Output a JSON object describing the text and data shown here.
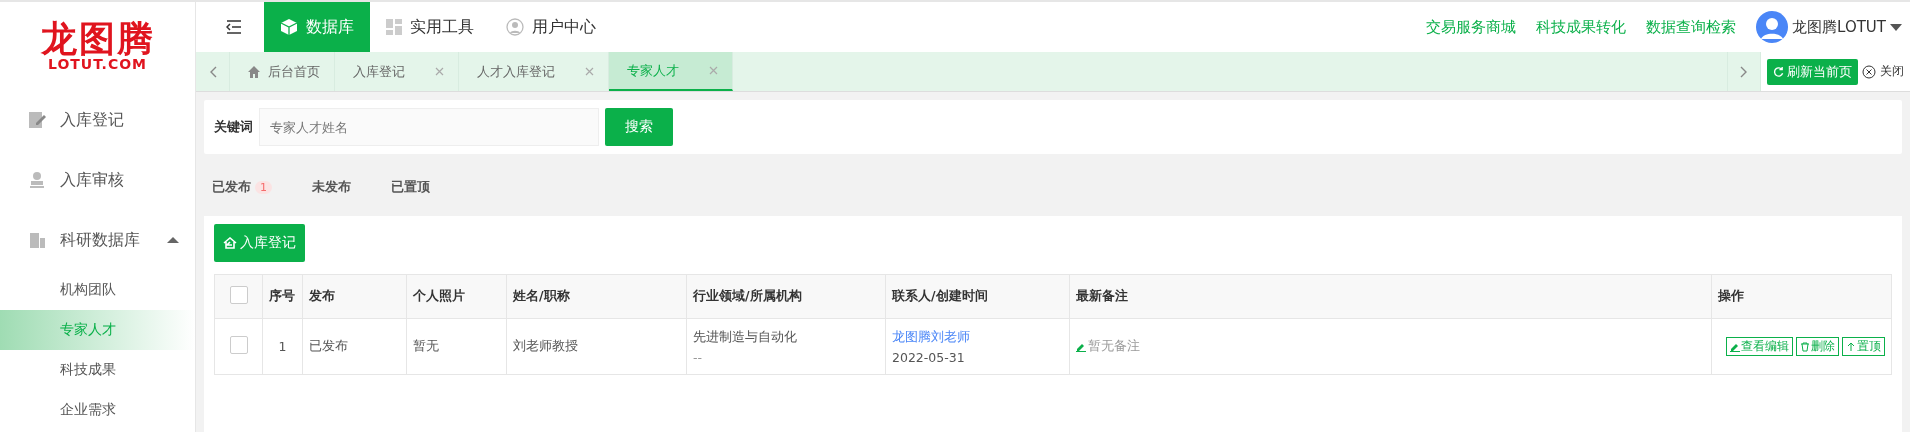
{
  "logo": {
    "title": "龙图腾",
    "subtitle": "LOTUT.COM"
  },
  "top_nav": [
    {
      "label": "数据库",
      "selected": true
    },
    {
      "label": "实用工具",
      "selected": false
    },
    {
      "label": "用户中心",
      "selected": false
    }
  ],
  "top_links": [
    "交易服务商城",
    "科技成果转化",
    "数据查询检索"
  ],
  "user": {
    "name": "龙图腾LOTUT"
  },
  "page_tabs": [
    {
      "label": "后台首页",
      "kind": "home",
      "selected": false
    },
    {
      "label": "入库登记",
      "kind": "closable",
      "selected": false
    },
    {
      "label": "人才入库登记",
      "kind": "closable",
      "selected": false
    },
    {
      "label": "专家人才",
      "kind": "closable",
      "selected": true
    }
  ],
  "refresh_button": "刷新当前页",
  "close_label": "关闭",
  "sidebar": {
    "items": [
      {
        "label": "入库登记"
      },
      {
        "label": "入库审核"
      },
      {
        "label": "科研数据库",
        "expanded": true,
        "children": [
          {
            "label": "机构团队",
            "selected": false
          },
          {
            "label": "专家人才",
            "selected": true
          },
          {
            "label": "科技成果",
            "selected": false
          },
          {
            "label": "企业需求",
            "selected": false
          }
        ]
      }
    ]
  },
  "search": {
    "label": "关键词",
    "placeholder": "专家人才姓名",
    "button": "搜索"
  },
  "status_tabs": [
    {
      "label": "已发布",
      "badge": "1"
    },
    {
      "label": "未发布"
    },
    {
      "label": "已置顶"
    }
  ],
  "add_button": "入库登记",
  "table": {
    "all_checked": false,
    "columns": [
      "序号",
      "发布",
      "个人照片",
      "姓名/职称",
      "行业领域/所属机构",
      "联系人/创建时间",
      "最新备注",
      "操作"
    ],
    "rows": [
      {
        "checked": false,
        "index": "1",
        "status": "已发布",
        "photo": "暂无",
        "name": "刘老师教授",
        "field": "先进制造与自动化",
        "org": "--",
        "contact": "龙图腾刘老师",
        "date": "2022-05-31",
        "note": "暂无备注",
        "actions": [
          "查看编辑",
          "删除",
          "置顶"
        ]
      }
    ]
  }
}
